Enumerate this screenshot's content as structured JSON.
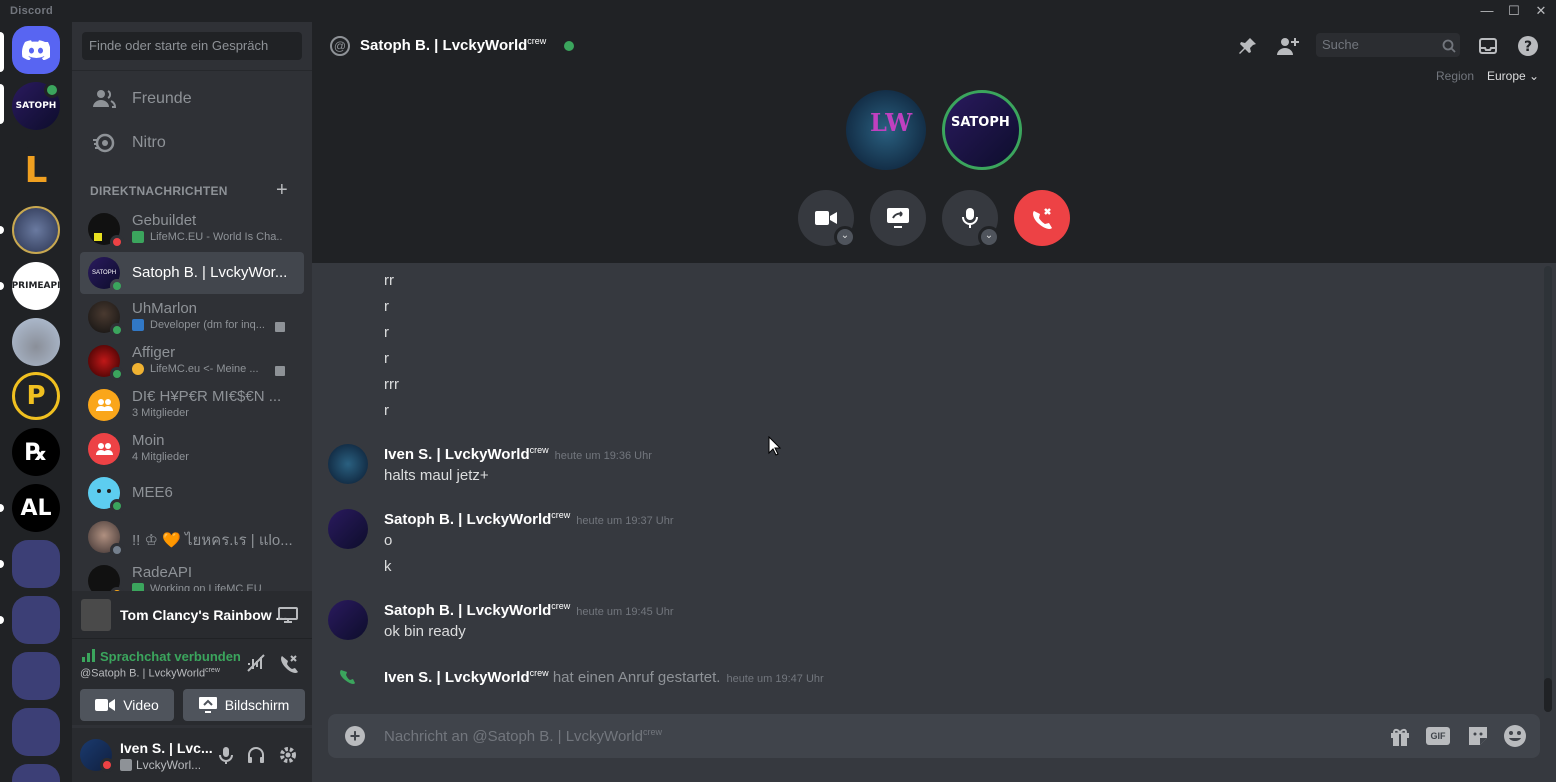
{
  "window": {
    "brand": "Discord",
    "minimize": "—",
    "maximize": "☐",
    "close": "✕"
  },
  "sidebar": {
    "search_placeholder": "Finde oder starte ein Gespräch",
    "nav": [
      {
        "label": "Freunde",
        "icon": "friends-icon"
      },
      {
        "label": "Nitro",
        "icon": "nitro-icon"
      }
    ],
    "dm_header": "DIREKTNACHRICHTEN",
    "dm_add": "+",
    "dms": [
      {
        "name": "Gebuildet",
        "sub": "LifeMC.EU - World Is Cha...",
        "status": "dnd"
      },
      {
        "name": "Satoph B. | LvckyWor...",
        "sub": "",
        "status": "online"
      },
      {
        "name": "UhMarlon",
        "sub": "Developer (dm for inq...",
        "status": "online"
      },
      {
        "name": "Affiger",
        "sub": "LifeMC.eu <- Meine ...",
        "status": "online"
      },
      {
        "name": "DI€ H¥P€R MI€$€N ...",
        "sub": "3 Mitglieder",
        "status": "group"
      },
      {
        "name": "Moin",
        "sub": "4 Mitglieder",
        "status": "group"
      },
      {
        "name": "MEE6",
        "sub": "",
        "status": "online"
      },
      {
        "name": "!! ♔ 🧡 ไยหคร.เร | แlo...",
        "sub": "",
        "status": "offline"
      },
      {
        "name": "RadeAPI",
        "sub": "Working on LifeMC.EU",
        "status": "idle"
      }
    ],
    "activity": {
      "title": "Tom Clancy's Rainbow ...",
      "icon": "screen-share-icon"
    },
    "voice": {
      "status": "Sprachchat verbunden",
      "channel": "@Satoph B. | LvckyWorld",
      "crew": "crew",
      "video_label": "Video",
      "screen_label": "Bildschirm"
    },
    "user": {
      "name": "Iven S. | Lvc...",
      "tag": "LvckyWorl..."
    }
  },
  "header": {
    "title": "Satoph B. | LvckyWorld",
    "crew": "crew",
    "search_placeholder": "Suche",
    "region_label": "Region",
    "region_value": "Europe"
  },
  "messages": {
    "continuation": [
      "rr",
      "r",
      "r",
      "r",
      "rrr",
      "r"
    ],
    "groups": [
      {
        "author": "Iven S. | LvckyWorld",
        "crew": "crew",
        "time": "heute um 19:36 Uhr",
        "lines": [
          "halts maul jetz+"
        ]
      },
      {
        "author": "Satoph B. | LvckyWorld",
        "crew": "crew",
        "time": "heute um 19:37 Uhr",
        "lines": [
          "o",
          "k"
        ]
      },
      {
        "author": "Satoph B. | LvckyWorld",
        "crew": "crew",
        "time": "heute um 19:45 Uhr",
        "lines": [
          "ok bin ready"
        ]
      }
    ],
    "system": {
      "author": "Iven S. | LvckyWorld",
      "crew": "crew",
      "text": "hat einen Anruf gestartet.",
      "time": "heute um 19:47 Uhr"
    }
  },
  "composer": {
    "placeholder": "Nachricht an @Satoph B. | LvckyWorld",
    "crew": "crew",
    "gif": "GIF"
  },
  "colors": {
    "accent": "#5865f2",
    "online": "#3ba55d",
    "danger": "#ed4245",
    "dnd": "#ed4245",
    "idle": "#faa81a"
  }
}
